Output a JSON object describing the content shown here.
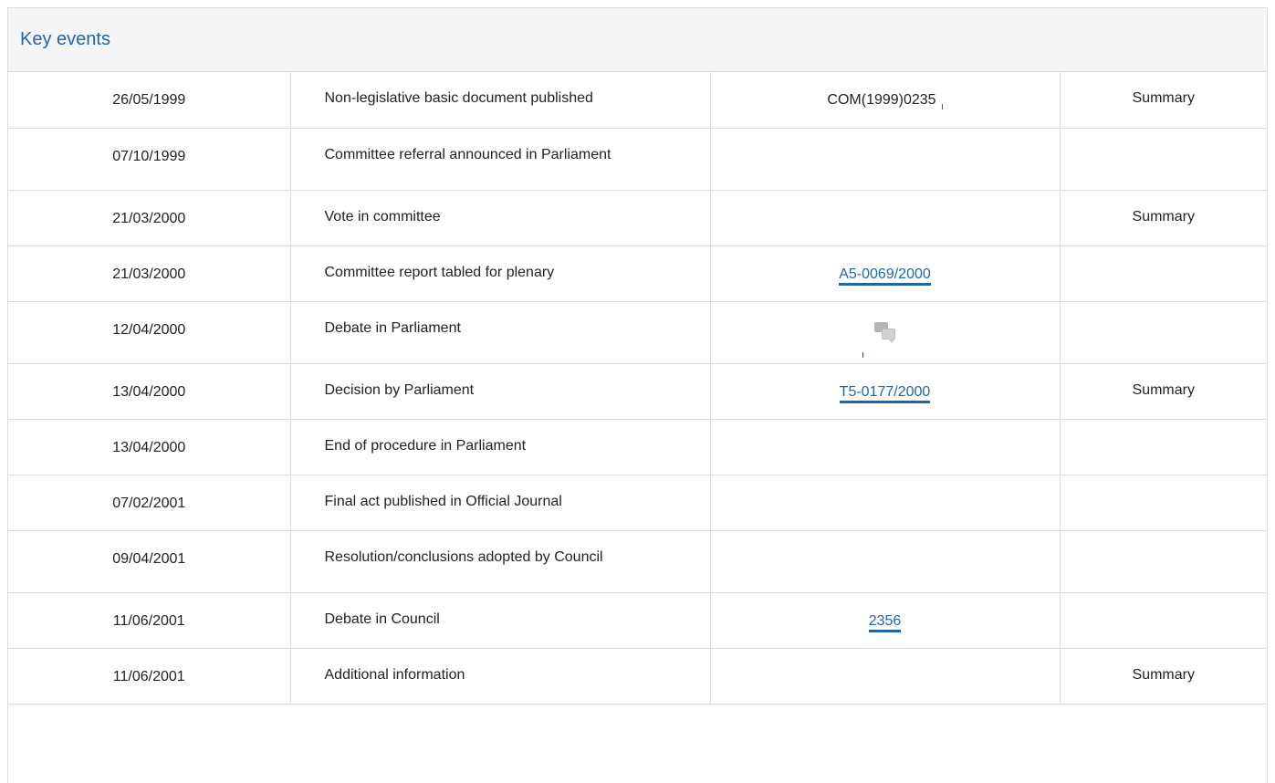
{
  "panel": {
    "title": "Key events"
  },
  "events": [
    {
      "date": "26/05/1999",
      "event": "Non-legislative basic document published",
      "ref": "COM(1999)0235",
      "ref_type": "plain",
      "summary": "Summary"
    },
    {
      "date": "07/10/1999",
      "event": "Committee referral announced in Parliament",
      "ref": "",
      "ref_type": "none",
      "summary": ""
    },
    {
      "date": "21/03/2000",
      "event": "Vote in committee",
      "ref": "",
      "ref_type": "none",
      "summary": "Summary"
    },
    {
      "date": "21/03/2000",
      "event": "Committee report tabled for plenary",
      "ref": "A5-0069/2000",
      "ref_type": "link",
      "summary": ""
    },
    {
      "date": "12/04/2000",
      "event": "Debate in Parliament",
      "ref": "",
      "ref_type": "icon",
      "icon": "debate-icon",
      "summary": ""
    },
    {
      "date": "13/04/2000",
      "event": "Decision by Parliament",
      "ref": "T5-0177/2000",
      "ref_type": "link",
      "summary": "Summary"
    },
    {
      "date": "13/04/2000",
      "event": "End of procedure in Parliament",
      "ref": "",
      "ref_type": "none",
      "summary": ""
    },
    {
      "date": "07/02/2001",
      "event": "Final act published in Official Journal",
      "ref": "",
      "ref_type": "none",
      "summary": ""
    },
    {
      "date": "09/04/2001",
      "event": "Resolution/conclusions adopted by Council",
      "ref": "",
      "ref_type": "none",
      "summary": ""
    },
    {
      "date": "11/06/2001",
      "event": "Debate in Council",
      "ref": "2356",
      "ref_type": "link",
      "summary": ""
    },
    {
      "date": "11/06/2001",
      "event": "Additional information",
      "ref": "",
      "ref_type": "none",
      "summary": "Summary"
    }
  ],
  "colors": {
    "link": "#2067a5",
    "border": "#dddddd",
    "header_bg": "#f5f5f5"
  }
}
